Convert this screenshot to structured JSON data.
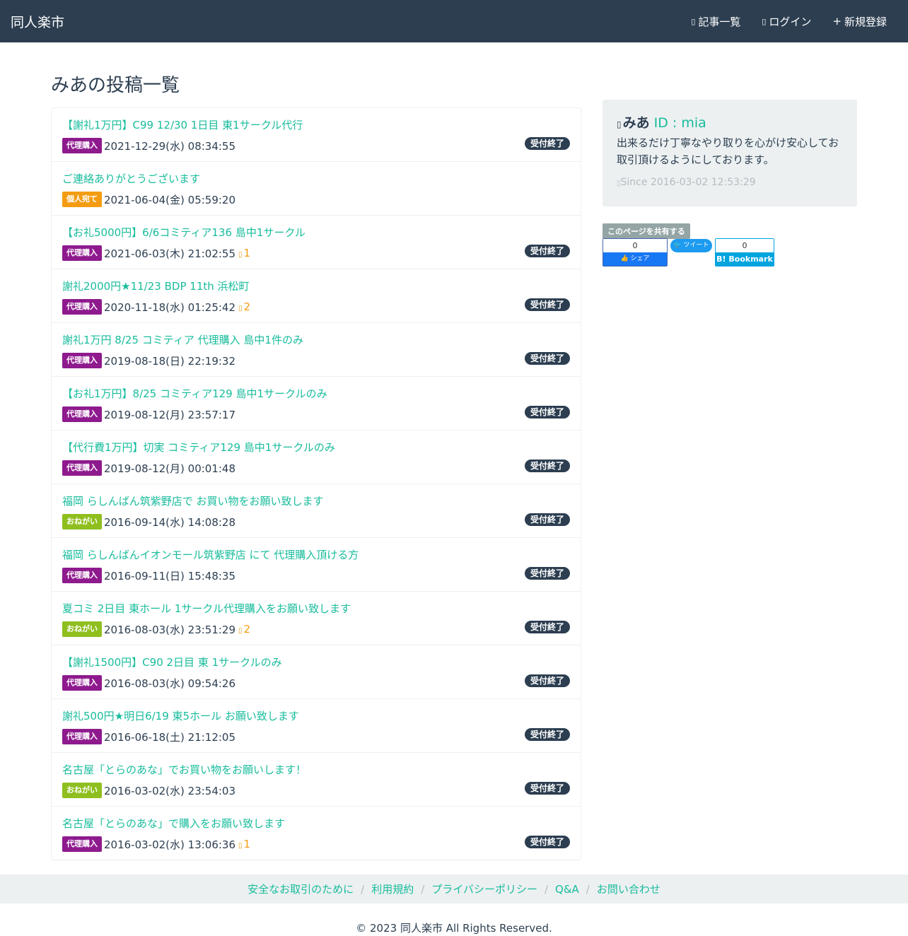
{
  "navbar": {
    "brand": "同人楽市",
    "items": [
      {
        "icon": "list-icon",
        "glyph": "▯",
        "label": "記事一覧"
      },
      {
        "icon": "login-icon",
        "glyph": "▯",
        "label": "ログイン"
      },
      {
        "icon": "plus-icon",
        "glyph": "+",
        "label": "新規登録"
      }
    ]
  },
  "page_title": "みあの投稿一覧",
  "colors": {
    "代理購入": "#8e1a8e",
    "個人宛て": "#f39c12",
    "おねがい": "#8fbf1f"
  },
  "posts": [
    {
      "title": "【謝礼1万円】C99 12/30 1日目 東1サークル代行",
      "label": "代理購入",
      "date": "2021-12-29(水) 08:34:55",
      "comments": "",
      "status": "受付終了"
    },
    {
      "title": "ご連絡ありがとうございます",
      "label": "個人宛て",
      "date": "2021-06-04(金) 05:59:20",
      "comments": "",
      "status": ""
    },
    {
      "title": "【お礼5000円】6/6コミティア136 島中1サークル",
      "label": "代理購入",
      "date": "2021-06-03(木) 21:02:55",
      "comments": "1",
      "status": "受付終了"
    },
    {
      "title": "謝礼2000円★11/23 BDP 11th 浜松町",
      "label": "代理購入",
      "date": "2020-11-18(水) 01:25:42",
      "comments": "2",
      "status": "受付終了"
    },
    {
      "title": "謝礼1万円 8/25 コミティア 代理購入 島中1件のみ",
      "label": "代理購入",
      "date": "2019-08-18(日) 22:19:32",
      "comments": "",
      "status": "受付終了"
    },
    {
      "title": "【お礼1万円】8/25 コミティア129 島中1サークルのみ",
      "label": "代理購入",
      "date": "2019-08-12(月) 23:57:17",
      "comments": "",
      "status": "受付終了"
    },
    {
      "title": "【代行費1万円】切実 コミティア129 島中1サークルのみ",
      "label": "代理購入",
      "date": "2019-08-12(月) 00:01:48",
      "comments": "",
      "status": "受付終了"
    },
    {
      "title": "福岡 らしんばん筑紫野店で お買い物をお願い致します",
      "label": "おねがい",
      "date": "2016-09-14(水) 14:08:28",
      "comments": "",
      "status": "受付終了"
    },
    {
      "title": "福岡 らしんばんイオンモール筑紫野店 にて 代理購入頂ける方",
      "label": "代理購入",
      "date": "2016-09-11(日) 15:48:35",
      "comments": "",
      "status": "受付終了"
    },
    {
      "title": "夏コミ 2日目 東ホール 1サークル代理購入をお願い致します",
      "label": "おねがい",
      "date": "2016-08-03(水) 23:51:29",
      "comments": "2",
      "status": "受付終了"
    },
    {
      "title": "【謝礼1500円】C90 2日目 東 1サークルのみ",
      "label": "代理購入",
      "date": "2016-08-03(水) 09:54:26",
      "comments": "",
      "status": "受付終了"
    },
    {
      "title": "謝礼500円★明日6/19 東5ホール お願い致します",
      "label": "代理購入",
      "date": "2016-06-18(土) 21:12:05",
      "comments": "",
      "status": "受付終了"
    },
    {
      "title": "名古屋「とらのあな」でお買い物をお願いします！",
      "label": "おねがい",
      "date": "2016-03-02(水) 23:54:03",
      "comments": "",
      "status": "受付終了"
    },
    {
      "title": "名古屋「とらのあな」で購入をお願い致します",
      "label": "代理購入",
      "date": "2016-03-02(水) 13:06:36",
      "comments": "1",
      "status": "受付終了"
    }
  ],
  "profile": {
    "name": "みあ",
    "id_text": "ID : mia",
    "description": "出来るだけ丁寧なやり取りを心がけ安心してお取引頂けるようにしております。",
    "since": "Since 2016-03-02 12:53:29"
  },
  "share": {
    "label": "このページを共有する",
    "facebook_count": "0",
    "facebook_button": "シェア",
    "twitter_button": "ツイート",
    "hatena_count": "0",
    "hatena_button": "B! Bookmark"
  },
  "footer": {
    "links": [
      "安全なお取引のために",
      "利用規約",
      "プライバシーポリシー",
      "Q&A",
      "お問い合わせ"
    ],
    "copyright": "© 2023 同人楽市 All Rights Reserved."
  }
}
